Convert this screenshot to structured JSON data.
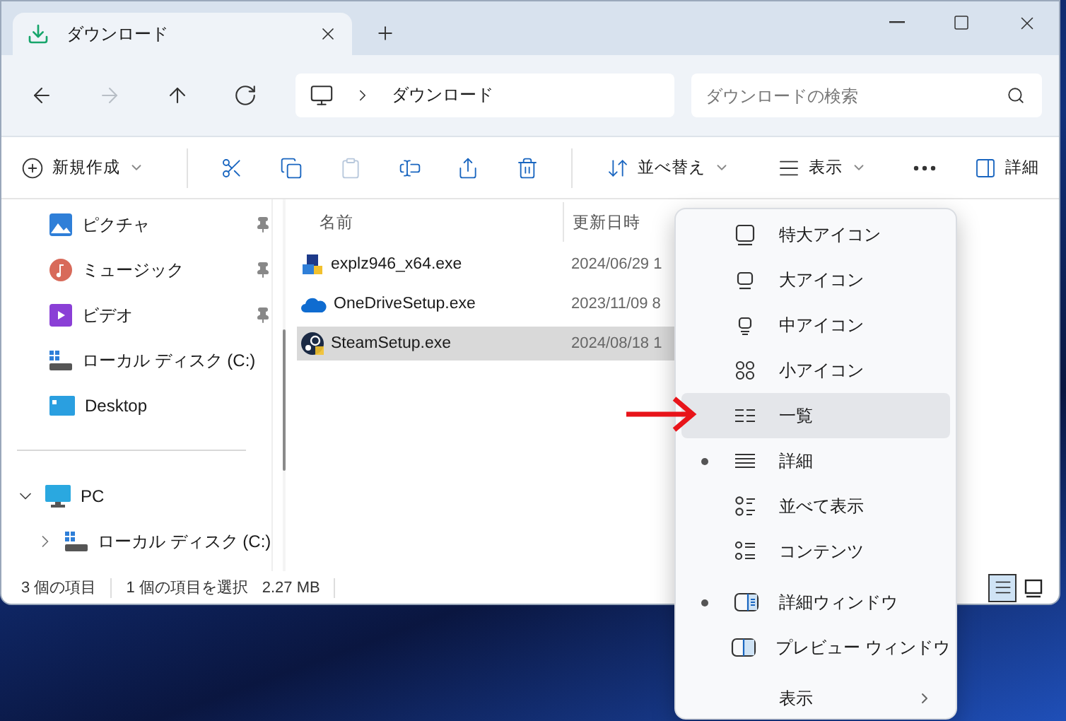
{
  "window": {
    "tab_title": "ダウンロード"
  },
  "address_bar": {
    "path": "ダウンロード",
    "search": {
      "placeholder": "ダウンロードの検索"
    },
    "nav": [
      {
        "disabled": false
      },
      {
        "disabled": true
      },
      {
        "disabled": false
      },
      {
        "disabled": false
      }
    ]
  },
  "toolbar": [
    {
      "kind": "create",
      "label": "新規作成",
      "disabled": false
    },
    {
      "kind": "separator"
    },
    {
      "kind": "cut",
      "disabled": false
    },
    {
      "kind": "copy",
      "disabled": false
    },
    {
      "kind": "paste",
      "disabled": true
    },
    {
      "kind": "rename",
      "disabled": false
    },
    {
      "kind": "share",
      "disabled": false
    },
    {
      "kind": "delete",
      "disabled": false
    },
    {
      "kind": "separator"
    },
    {
      "kind": "sort",
      "label": "並べ替え",
      "disabled": false
    },
    {
      "kind": "view",
      "label": "表示",
      "disabled": false
    },
    {
      "kind": "more",
      "disabled": false
    },
    {
      "kind": "details",
      "label": "詳細",
      "disabled": false
    }
  ],
  "sidebar": {
    "items": [
      {
        "label": "ピクチャ",
        "kind": "pictures",
        "pinned": true
      },
      {
        "label": "ミュージック",
        "kind": "music",
        "pinned": true
      },
      {
        "label": "ビデオ",
        "kind": "videos",
        "pinned": true
      },
      {
        "label": "ローカル ディスク (C:)",
        "kind": "drive",
        "pinned": false
      },
      {
        "label": "Desktop",
        "kind": "desktop",
        "pinned": false
      }
    ],
    "tree": [
      {
        "label": "PC",
        "kind": "pc",
        "expanded": true,
        "children": [
          {
            "label": "ローカル ディスク (C:)",
            "kind": "drive",
            "expanded": false
          }
        ]
      }
    ]
  },
  "files": {
    "columns": [
      "名前",
      "更新日時"
    ],
    "rows": [
      {
        "name": "explz946_x64.exe",
        "date": "2024/06/29 1",
        "kind": "installer",
        "selected": false
      },
      {
        "name": "OneDriveSetup.exe",
        "date": "2023/11/09 8",
        "kind": "cloud",
        "selected": false
      },
      {
        "name": "SteamSetup.exe",
        "date": "2024/08/18 1",
        "kind": "steam",
        "selected": true
      }
    ]
  },
  "status_bar": {
    "count": "3 個の項目",
    "selection": "1 個の項目を選択",
    "size": "2.27 MB",
    "views": [
      {
        "kind": "details",
        "selected": true
      },
      {
        "kind": "thumbnails",
        "selected": false
      }
    ]
  },
  "view_menu": {
    "sections": [
      [
        {
          "label": "特大アイコン",
          "kind": "xl",
          "selected": false,
          "highlighted": false
        },
        {
          "label": "大アイコン",
          "kind": "large",
          "selected": false,
          "highlighted": false
        },
        {
          "label": "中アイコン",
          "kind": "medium",
          "selected": false,
          "highlighted": false
        },
        {
          "label": "小アイコン",
          "kind": "small",
          "selected": false,
          "highlighted": false
        },
        {
          "label": "一覧",
          "kind": "list",
          "selected": false,
          "highlighted": true
        },
        {
          "label": "詳細",
          "kind": "details",
          "selected": true,
          "highlighted": false
        },
        {
          "label": "並べて表示",
          "kind": "tiles",
          "selected": false,
          "highlighted": false
        },
        {
          "label": "コンテンツ",
          "kind": "content",
          "selected": false,
          "highlighted": false
        }
      ],
      [
        {
          "label": "詳細ウィンドウ",
          "kind": "details_pane",
          "selected": true,
          "highlighted": false
        },
        {
          "label": "プレビュー ウィンドウ",
          "kind": "preview_pane",
          "selected": false,
          "highlighted": false
        }
      ],
      [
        {
          "label": "表示",
          "kind": "submenu",
          "selected": false,
          "highlighted": false
        }
      ]
    ]
  }
}
